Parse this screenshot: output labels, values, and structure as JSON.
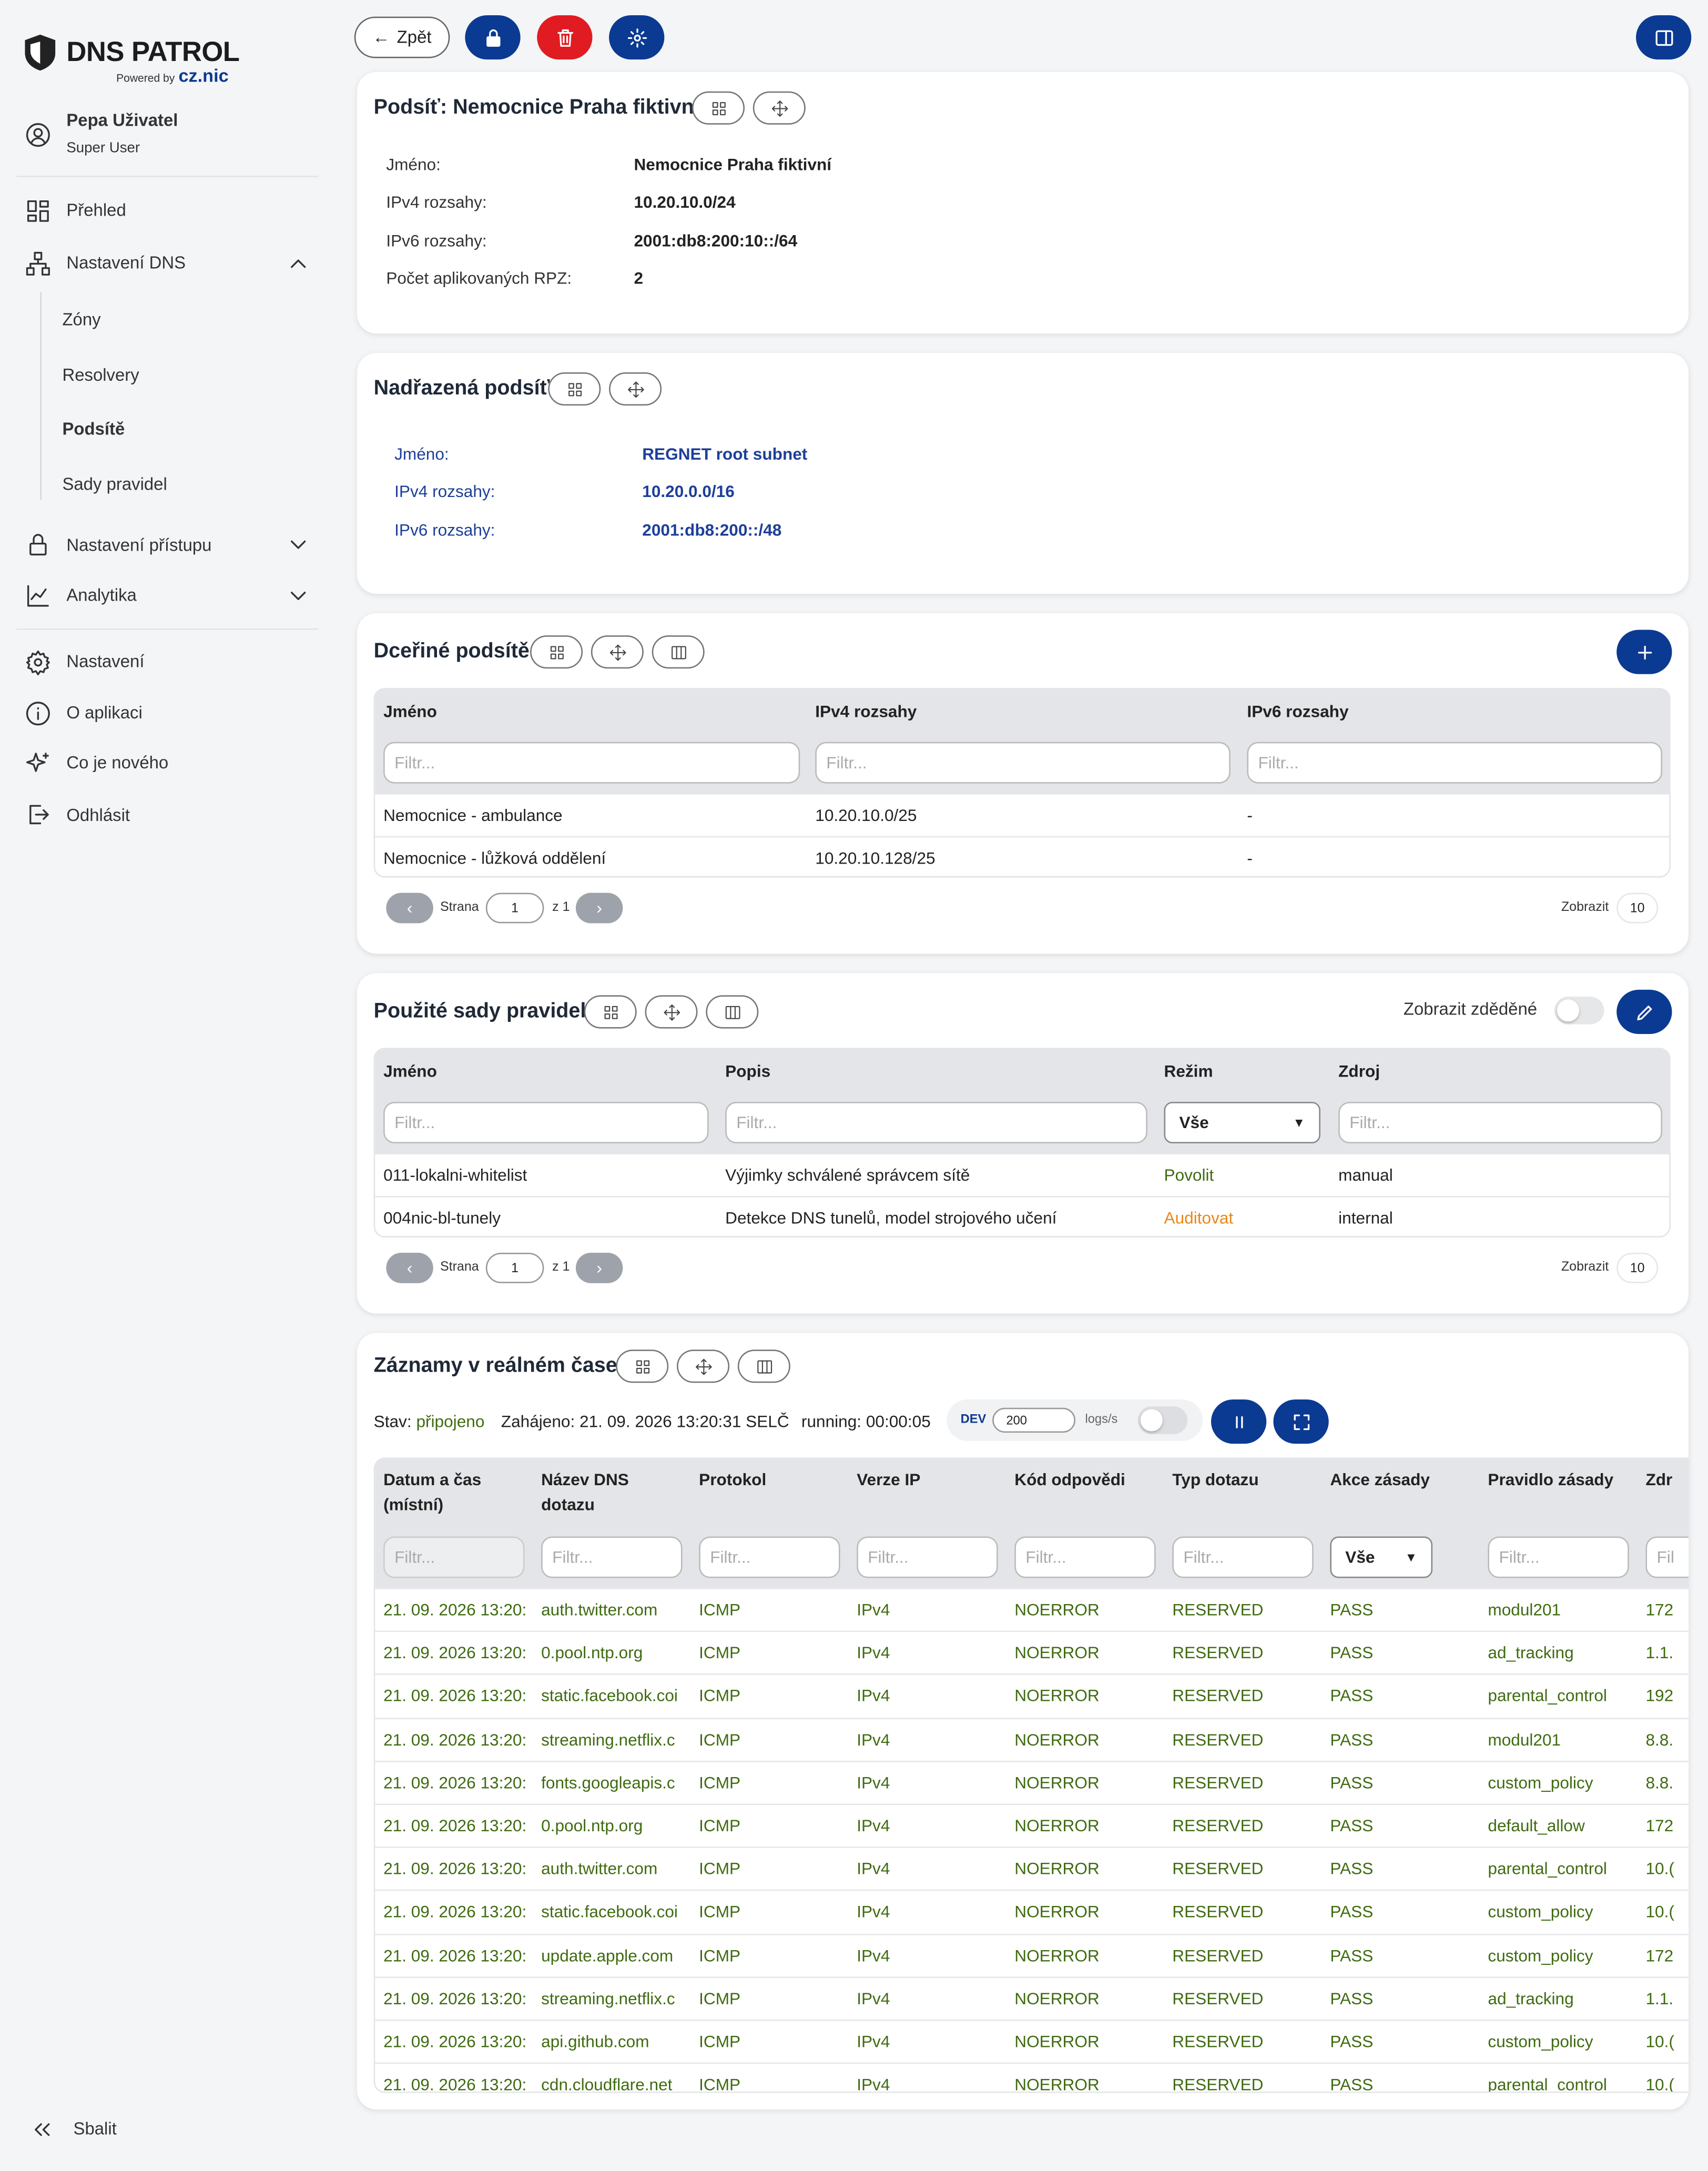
{
  "brand": {
    "name": "DNS PATROL",
    "powered_by": "Powered by",
    "partner": "cz.nic",
    "primary": "#0b3a93",
    "danger": "#e11b22"
  },
  "user": {
    "name": "Pepa Uživatel",
    "role": "Super User"
  },
  "sidebar": {
    "overview": "Přehled",
    "dns_settings": "Nastavení DNS",
    "sub": [
      "Zóny",
      "Resolvery",
      "Podsítě",
      "Sady pravidel"
    ],
    "access": "Nastavení přístupu",
    "analytics": "Analytika",
    "settings": "Nastavení",
    "about": "O aplikaci",
    "whats_new": "Co je nového",
    "logout": "Odhlásit",
    "collapse": "Sbalit"
  },
  "toolbar": {
    "back": "Zpět"
  },
  "subnet": {
    "title": "Podsíť: Nemocnice Praha fiktivní",
    "labels": [
      "Jméno:",
      "IPv4 rozsahy:",
      "IPv6 rozsahy:",
      "Počet aplikovaných RPZ:"
    ],
    "values": [
      "Nemocnice Praha fiktivní",
      "10.20.10.0/24",
      "2001:db8:200:10::/64",
      "2"
    ]
  },
  "parent": {
    "title": "Nadřazená podsíť",
    "labels": [
      "Jméno:",
      "IPv4 rozsahy:",
      "IPv6 rozsahy:"
    ],
    "values": [
      "REGNET root subnet",
      "10.20.0.0/16",
      "2001:db8:200::/48"
    ]
  },
  "children": {
    "title": "Dceřiné podsítě",
    "headers": [
      "Jméno",
      "IPv4 rozsahy",
      "IPv6 rozsahy"
    ],
    "filter": "Filtr...",
    "rows": [
      [
        "Nemocnice - ambulance",
        "10.20.10.0/25",
        "-"
      ],
      [
        "Nemocnice - lůžková oddělení",
        "10.20.10.128/25",
        "-"
      ]
    ],
    "page_label": "Strana",
    "page": "1",
    "of": "z 1",
    "show_label": "Zobrazit",
    "show": "10"
  },
  "rulesets": {
    "title": "Použité sady pravidel",
    "inherited": "Zobrazit zděděné",
    "headers": [
      "Jméno",
      "Popis",
      "Režim",
      "Zdroj"
    ],
    "filter": "Filtr...",
    "mode_select": "Vše",
    "rows": [
      [
        "011-lokalni-whitelist",
        "Výjimky schválené správcem sítě",
        "Povolit",
        "manual"
      ],
      [
        "004nic-bl-tunely",
        "Detekce DNS tunelů, model strojového učení",
        "Auditovat",
        "internal"
      ]
    ],
    "mode_colors": [
      "#3f6b10",
      "#e8861a"
    ],
    "page_label": "Strana",
    "page": "1",
    "of": "z 1",
    "show_label": "Zobrazit",
    "show": "10"
  },
  "realtime": {
    "title": "Záznamy v reálném čase",
    "status_label": "Stav:",
    "status": "připojeno",
    "started": "Zahájeno: 21. 09. 2026 13:20:31 SELČ",
    "running": "running: 00:00:05",
    "dev": "DEV",
    "rate": "200",
    "rate_unit": "logs/s",
    "headers": [
      "Datum a čas (místní)",
      "Název DNS dotazu",
      "Protokol",
      "Verze IP",
      "Kód odpovědi",
      "Typ dotazu",
      "Akce zásady",
      "Pravidlo zásady",
      "Zdr"
    ],
    "filter": "Filtr...",
    "filter_short": "Fil",
    "action_select": "Vše",
    "rows": [
      [
        "21. 09. 2026 13:20:",
        "auth.twitter.com",
        "ICMP",
        "IPv4",
        "NOERROR",
        "RESERVED",
        "PASS",
        "modul201",
        "172"
      ],
      [
        "21. 09. 2026 13:20:",
        "0.pool.ntp.org",
        "ICMP",
        "IPv4",
        "NOERROR",
        "RESERVED",
        "PASS",
        "ad_tracking",
        "1.1."
      ],
      [
        "21. 09. 2026 13:20:",
        "static.facebook.coi",
        "ICMP",
        "IPv4",
        "NOERROR",
        "RESERVED",
        "PASS",
        "parental_control",
        "192"
      ],
      [
        "21. 09. 2026 13:20:",
        "streaming.netflix.c",
        "ICMP",
        "IPv4",
        "NOERROR",
        "RESERVED",
        "PASS",
        "modul201",
        "8.8."
      ],
      [
        "21. 09. 2026 13:20:",
        "fonts.googleapis.c",
        "ICMP",
        "IPv4",
        "NOERROR",
        "RESERVED",
        "PASS",
        "custom_policy",
        "8.8."
      ],
      [
        "21. 09. 2026 13:20:",
        "0.pool.ntp.org",
        "ICMP",
        "IPv4",
        "NOERROR",
        "RESERVED",
        "PASS",
        "default_allow",
        "172"
      ],
      [
        "21. 09. 2026 13:20:",
        "auth.twitter.com",
        "ICMP",
        "IPv4",
        "NOERROR",
        "RESERVED",
        "PASS",
        "parental_control",
        "10.("
      ],
      [
        "21. 09. 2026 13:20:",
        "static.facebook.coi",
        "ICMP",
        "IPv4",
        "NOERROR",
        "RESERVED",
        "PASS",
        "custom_policy",
        "10.("
      ],
      [
        "21. 09. 2026 13:20:",
        "update.apple.com",
        "ICMP",
        "IPv4",
        "NOERROR",
        "RESERVED",
        "PASS",
        "custom_policy",
        "172"
      ],
      [
        "21. 09. 2026 13:20:",
        "streaming.netflix.c",
        "ICMP",
        "IPv4",
        "NOERROR",
        "RESERVED",
        "PASS",
        "ad_tracking",
        "1.1."
      ],
      [
        "21. 09. 2026 13:20:",
        "api.github.com",
        "ICMP",
        "IPv4",
        "NOERROR",
        "RESERVED",
        "PASS",
        "custom_policy",
        "10.("
      ],
      [
        "21. 09. 2026 13:20:",
        "cdn.cloudflare.net",
        "ICMP",
        "IPv4",
        "NOERROR",
        "RESERVED",
        "PASS",
        "parental_control",
        "10.("
      ]
    ]
  }
}
